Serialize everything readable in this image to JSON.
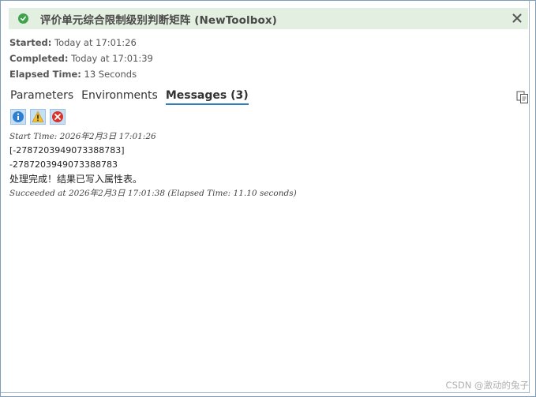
{
  "title_bar": {
    "status_icon": "success-check-icon",
    "title": "评价单元综合限制级别判断矩阵 (NewToolbox)",
    "close_icon": "close-icon"
  },
  "meta": {
    "started_label": "Started:",
    "started_value": "Today at 17:01:26",
    "completed_label": "Completed:",
    "completed_value": "Today at 17:01:39",
    "elapsed_label": "Elapsed Time:",
    "elapsed_value": "13 Seconds"
  },
  "tabs": [
    {
      "label": "Parameters",
      "active": false
    },
    {
      "label": "Environments",
      "active": false
    },
    {
      "label": "Messages (3)",
      "active": true
    }
  ],
  "toolbar": {
    "copy_icon": "copy-icon",
    "filters": [
      {
        "icon": "info-icon"
      },
      {
        "icon": "warning-icon"
      },
      {
        "icon": "error-icon"
      }
    ]
  },
  "messages": [
    {
      "text": "Start Time: 2026年2月3日 17:01:26",
      "style": "italic"
    },
    {
      "text": "[-2787203949073388783]",
      "style": "plain"
    },
    {
      "text": "-2787203949073388783",
      "style": "plain"
    },
    {
      "text": "处理完成！结果已写入属性表。",
      "style": "plain big"
    },
    {
      "text": "Succeeded at 2026年2月3日 17:01:38 (Elapsed Time: 11.10 seconds)",
      "style": "italic"
    }
  ],
  "watermark": "CSDN @激动的兔子",
  "colors": {
    "title_bg": "#e3efe0",
    "success": "#3ea34a",
    "tab_underline": "#2d7fc1",
    "filter_bg": "#c7dff3"
  }
}
